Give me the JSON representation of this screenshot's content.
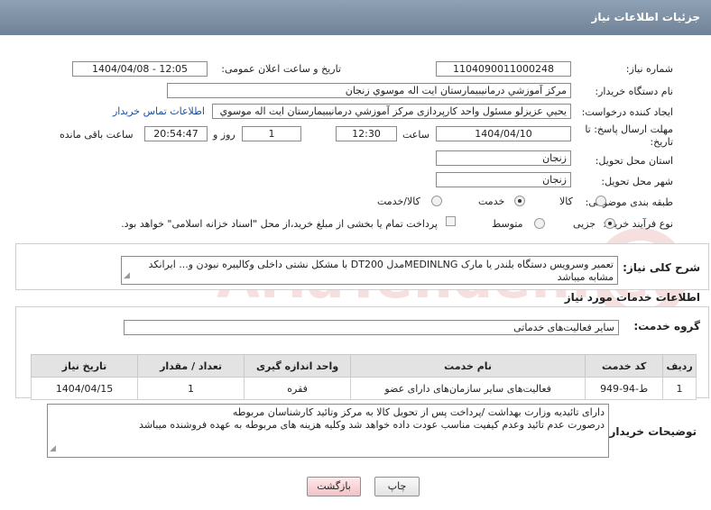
{
  "header": {
    "title": "جزئیات اطلاعات نیاز"
  },
  "fields": {
    "need_number": {
      "label": "شماره نیاز:",
      "value": "1104090011000248"
    },
    "announce_datetime": {
      "label": "تاریخ و ساعت اعلان عمومی:",
      "value": "1404/04/08 - 12:05"
    },
    "buyer_org": {
      "label": "نام دستگاه خریدار:",
      "value": "مرکز آموزشي درمانيبيمارستان ايت اله موسوي زنجان"
    },
    "requester": {
      "label": "ایجاد کننده درخواست:",
      "value": "يحيي عزيزلو مسئول واحد کارپردازی مرکز آموزشي درمانيبيمارستان ايت اله موسوي",
      "contact_link": "اطلاعات تماس خریدار"
    },
    "deadline": {
      "label": "مهلت ارسال پاسخ: تا تاریخ:",
      "date": "1404/04/10",
      "time_label": "ساعت",
      "time": "12:30",
      "days": "1",
      "days_label": "روز و",
      "remaining": "20:54:47",
      "remaining_label": "ساعت باقی مانده"
    },
    "province": {
      "label": "استان محل تحویل:",
      "value": "زنجان"
    },
    "city": {
      "label": "شهر محل تحویل:",
      "value": "زنجان"
    },
    "category": {
      "label": "طبقه بندی موضوعی:",
      "options": [
        "کالا",
        "خدمت",
        "کالا/خدمت"
      ],
      "selected": "خدمت"
    },
    "process": {
      "label": "نوع فرآیند خرید :",
      "options": [
        "جزیی",
        "متوسط"
      ],
      "selected": "جزیی",
      "note": "پرداخت تمام یا بخشی از مبلغ خرید،از محل \"اسناد خزانه اسلامی\" خواهد بود."
    }
  },
  "summary": {
    "label": "شرح کلی نیاز:",
    "text": "تعمیر وسرویس دستگاه بلندر یا مارک MEDINLNGمدل DT200 با مشکل نشتی داخلی وکالیبره نبودن و... ایرانکد مشابه میباشد"
  },
  "services": {
    "title": "اطلاعات خدمات مورد نیاز",
    "group_label": "گروه خدمت:",
    "group_value": "سایر فعالیت‌های خدماتی",
    "columns": [
      "ردیف",
      "کد خدمت",
      "نام خدمت",
      "واحد اندازه گیری",
      "تعداد / مقدار",
      "تاریخ نیاز"
    ],
    "rows": [
      [
        "1",
        "ط-94-949",
        "فعالیت‌های سایر سازمان‌های دارای عضو",
        "فقره",
        "1",
        "1404/04/15"
      ]
    ]
  },
  "buyer_notes": {
    "label": "توضیحات خریدار:",
    "line1": "دارای تائیدیه وزارت بهداشت /پرداخت پس از تحویل کالا به مرکز وتائید کارشناسان مربوطه",
    "line2": "درصورت عدم تائید وعدم کیفیت مناسب عودت داده خواهد شد وکلیه هزینه های مربوطه به عهده فروشنده میباشد"
  },
  "buttons": {
    "print": "چاپ",
    "back": "بازگشت"
  },
  "watermark": "AriaTender.net",
  "colors": {
    "header": "#7b8ea3",
    "link": "#1a4f9c",
    "back_button": "#f2c2c6"
  }
}
